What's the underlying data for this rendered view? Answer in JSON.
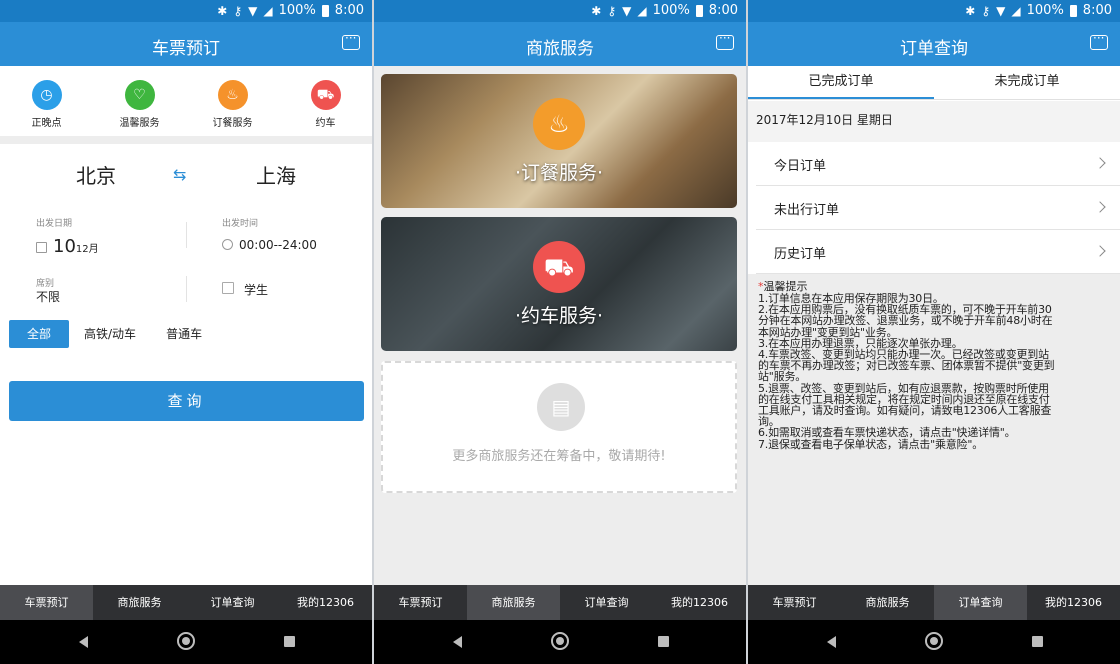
{
  "status": {
    "battery": "100%",
    "time": "8:00",
    "network": "LTE"
  },
  "bottom_nav": [
    "车票预订",
    "商旅服务",
    "订单查询",
    "我的12306"
  ],
  "panel1": {
    "title": "车票预订",
    "quick_actions": [
      {
        "label": "正晚点",
        "icon": "clock-icon",
        "color": "#2b9fe8"
      },
      {
        "label": "温馨服务",
        "icon": "heart-hand-icon",
        "color": "#3fb63f"
      },
      {
        "label": "订餐服务",
        "icon": "meal-icon",
        "color": "#f5922b"
      },
      {
        "label": "约车",
        "icon": "car-icon",
        "color": "#ef5350"
      }
    ],
    "from_city": "北京",
    "to_city": "上海",
    "date_label": "出发日期",
    "date_day": "10",
    "date_month": "12月",
    "time_label": "出发时间",
    "time_value": "00:00--24:00",
    "seat_label": "席别",
    "seat_value": "不限",
    "student_label": "学生",
    "train_types": [
      "全部",
      "高铁/动车",
      "普通车"
    ],
    "search_button": "查询"
  },
  "panel2": {
    "title": "商旅服务",
    "card1": "·订餐服务·",
    "card2": "·约车服务·",
    "coming_soon": "更多商旅服务还在筹备中，敬请期待!"
  },
  "panel3": {
    "title": "订单查询",
    "tabs": [
      "已完成订单",
      "未完成订单"
    ],
    "date": "2017年12月10日 星期日",
    "rows": [
      "今日订单",
      "未出行订单",
      "历史订单"
    ],
    "notice_title": "温馨提示",
    "notice_lines": [
      "1.订单信息在本应用保存期限为30日。",
      "2.在本应用购票后，没有换取纸质车票的，可不晚于开车前30",
      "分钟在本网站办理改签、退票业务，或不晚于开车前48小时在",
      "本网站办理\"变更到站\"业务。",
      "3.在本应用办理退票，只能逐次单张办理。",
      "4.车票改签、变更到站均只能办理一次。已经改签或变更到站",
      "的车票不再办理改签；对已改签车票、团体票暂不提供\"变更到",
      "站\"服务。",
      "5.退票、改签、变更到站后，如有应退票款，按购票时所使用",
      "的在线支付工具相关规定，将在规定时间内退还至原在线支付",
      "工具账户，请及时查询。如有疑问，请致电12306人工客服查",
      "询。",
      "6.如需取消或查看车票快递状态，请点击\"快递详情\"。",
      "7.退保或查看电子保单状态，请点击\"乘意险\"。"
    ]
  }
}
